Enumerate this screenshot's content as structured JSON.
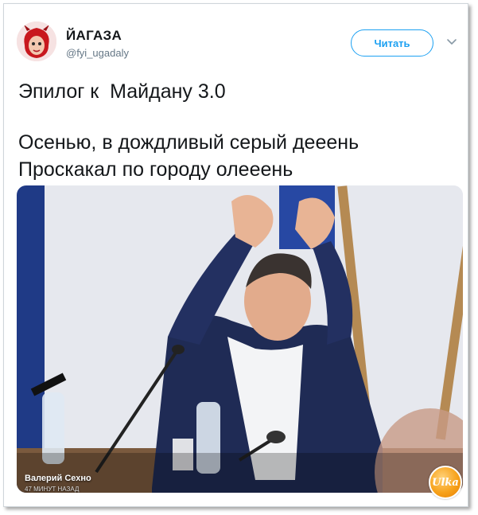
{
  "tweet": {
    "author_name": "ЙАГАЗА",
    "author_handle": "@fyi_ugadaly",
    "follow_label": "Читать",
    "text_line1": "Эпилог к  Майдану 3.0",
    "text_line2": "Осенью, в дождливый серый дееень",
    "text_line3": "Проскакал по городу олееень"
  },
  "media": {
    "caption": "Валерий Сехно",
    "time_label": "47 МИНУТ НАЗАД"
  },
  "watermark": {
    "logo_text": "Ulka"
  },
  "colors": {
    "accent": "#1da1f2",
    "text": "#14171a",
    "muted": "#657786",
    "border": "#cfd5da"
  },
  "icons": {
    "caret": "chevron-down-icon",
    "avatar": "avatar-image"
  }
}
